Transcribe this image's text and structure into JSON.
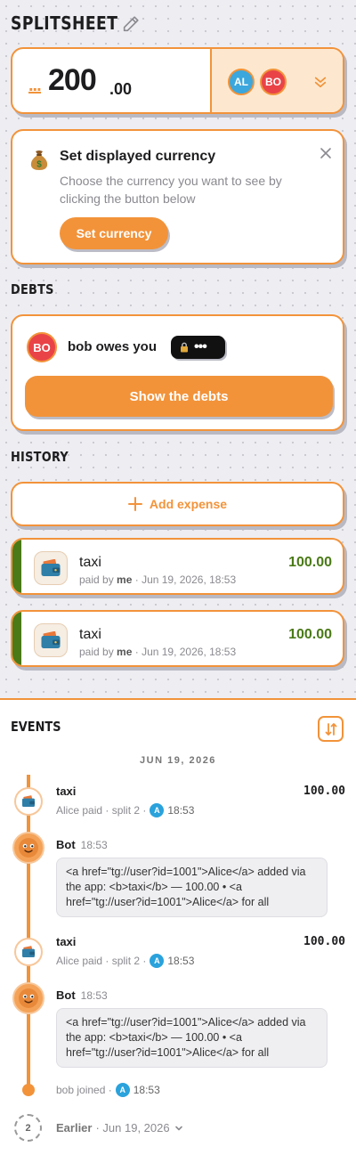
{
  "header": {
    "title": "SPLITSHEET"
  },
  "balance": {
    "hidden_prefix": "...",
    "integer_part": "200",
    "decimal_part": ".00",
    "members": [
      {
        "initials": "AL",
        "color": "#3ba7dd"
      },
      {
        "initials": "BO",
        "color": "#e94348"
      }
    ]
  },
  "currency_notice": {
    "title": "Set displayed currency",
    "description": "Choose the currency you want to see by clicking the button below",
    "button_label": "Set currency"
  },
  "debts": {
    "section_label": "DEBTS",
    "debtor_initials": "BO",
    "summary": "bob owes you",
    "hidden_amount": "•••",
    "button_label": "Show the debts"
  },
  "history": {
    "section_label": "HISTORY",
    "add_label": "Add expense",
    "expenses": [
      {
        "name": "taxi",
        "paid_by_prefix": "paid by",
        "payer": "me",
        "date": "· Jun 19, 2026, 18:53",
        "amount": "100.00"
      },
      {
        "name": "taxi",
        "paid_by_prefix": "paid by",
        "payer": "me",
        "date": "· Jun 19, 2026, 18:53",
        "amount": "100.00"
      }
    ]
  },
  "events": {
    "section_label": "EVENTS",
    "date_separator": "JUN 19, 2026",
    "items": [
      {
        "kind": "expense",
        "title": "taxi",
        "amount": "100.00",
        "meta": "Alice paid · split 2 ·",
        "avatar": "A",
        "time": "18:53"
      },
      {
        "kind": "bot",
        "name": "Bot",
        "time": "18:53",
        "message": "<a href=\"tg://user?id=1001\">Alice</a> added via the app: <b>taxi</b> — 100.00 • <a href=\"tg://user?id=1001\">Alice</a> for all"
      },
      {
        "kind": "expense",
        "title": "taxi",
        "amount": "100.00",
        "meta": "Alice paid · split 2 ·",
        "avatar": "A",
        "time": "18:53"
      },
      {
        "kind": "bot",
        "name": "Bot",
        "time": "18:53",
        "message": "<a href=\"tg://user?id=1001\">Alice</a> added via the app: <b>taxi</b> — 100.00 • <a href=\"tg://user?id=1001\">Alice</a> for all"
      }
    ],
    "join": {
      "text": "bob joined ·",
      "avatar": "A",
      "time": "18:53"
    },
    "earlier": {
      "count": "2",
      "label": "Earlier",
      "date": "· Jun 19, 2026"
    }
  },
  "colors": {
    "accent": "#f2933a",
    "positive": "#4a7a17",
    "background": "#eeeef2"
  }
}
